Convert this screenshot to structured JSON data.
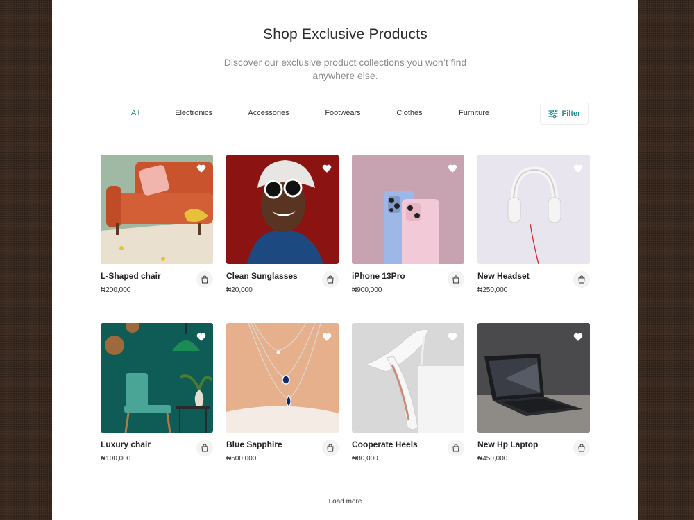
{
  "header": {
    "title": "Shop Exclusive Products",
    "subtitle": "Discover our exclusive product collections you won’t find anywhere else."
  },
  "categories": {
    "active": "All",
    "items": [
      "All",
      "Electronics",
      "Accessories",
      "Footwears",
      "Clothes",
      "Furniture"
    ]
  },
  "filter": {
    "label": "Filter",
    "icon": "sliders-icon"
  },
  "products": [
    {
      "name": "L-Shaped chair",
      "price": "₦200,000"
    },
    {
      "name": "Clean Sunglasses",
      "price": "₦20,000"
    },
    {
      "name": "iPhone 13Pro",
      "price": "₦900,000"
    },
    {
      "name": "New Headset",
      "price": "₦250,000"
    },
    {
      "name": "Luxury chair",
      "price": "₦100,000"
    },
    {
      "name": "Blue Sapphire",
      "price": "₦500,000"
    },
    {
      "name": "Cooperate Heels",
      "price": "₦80,000"
    },
    {
      "name": "New Hp Laptop",
      "price": "₦450,000"
    }
  ],
  "icons": {
    "favorite": "heart-icon",
    "cart": "shopping-bag-icon"
  },
  "colors": {
    "accent": "#1f8a8a",
    "text": "#222222",
    "muted": "#8a8a8a"
  },
  "footer": {
    "load_more": "Load more"
  }
}
